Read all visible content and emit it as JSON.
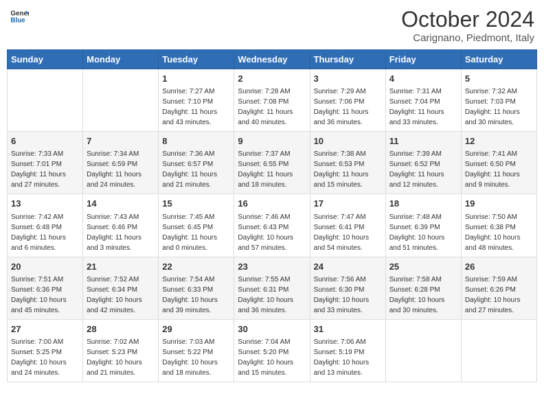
{
  "header": {
    "logo_line1": "General",
    "logo_line2": "Blue",
    "month": "October 2024",
    "location": "Carignano, Piedmont, Italy"
  },
  "days_of_week": [
    "Sunday",
    "Monday",
    "Tuesday",
    "Wednesday",
    "Thursday",
    "Friday",
    "Saturday"
  ],
  "weeks": [
    [
      {
        "day": "",
        "info": ""
      },
      {
        "day": "",
        "info": ""
      },
      {
        "day": "1",
        "info": "Sunrise: 7:27 AM\nSunset: 7:10 PM\nDaylight: 11 hours and 43 minutes."
      },
      {
        "day": "2",
        "info": "Sunrise: 7:28 AM\nSunset: 7:08 PM\nDaylight: 11 hours and 40 minutes."
      },
      {
        "day": "3",
        "info": "Sunrise: 7:29 AM\nSunset: 7:06 PM\nDaylight: 11 hours and 36 minutes."
      },
      {
        "day": "4",
        "info": "Sunrise: 7:31 AM\nSunset: 7:04 PM\nDaylight: 11 hours and 33 minutes."
      },
      {
        "day": "5",
        "info": "Sunrise: 7:32 AM\nSunset: 7:03 PM\nDaylight: 11 hours and 30 minutes."
      }
    ],
    [
      {
        "day": "6",
        "info": "Sunrise: 7:33 AM\nSunset: 7:01 PM\nDaylight: 11 hours and 27 minutes."
      },
      {
        "day": "7",
        "info": "Sunrise: 7:34 AM\nSunset: 6:59 PM\nDaylight: 11 hours and 24 minutes."
      },
      {
        "day": "8",
        "info": "Sunrise: 7:36 AM\nSunset: 6:57 PM\nDaylight: 11 hours and 21 minutes."
      },
      {
        "day": "9",
        "info": "Sunrise: 7:37 AM\nSunset: 6:55 PM\nDaylight: 11 hours and 18 minutes."
      },
      {
        "day": "10",
        "info": "Sunrise: 7:38 AM\nSunset: 6:53 PM\nDaylight: 11 hours and 15 minutes."
      },
      {
        "day": "11",
        "info": "Sunrise: 7:39 AM\nSunset: 6:52 PM\nDaylight: 11 hours and 12 minutes."
      },
      {
        "day": "12",
        "info": "Sunrise: 7:41 AM\nSunset: 6:50 PM\nDaylight: 11 hours and 9 minutes."
      }
    ],
    [
      {
        "day": "13",
        "info": "Sunrise: 7:42 AM\nSunset: 6:48 PM\nDaylight: 11 hours and 6 minutes."
      },
      {
        "day": "14",
        "info": "Sunrise: 7:43 AM\nSunset: 6:46 PM\nDaylight: 11 hours and 3 minutes."
      },
      {
        "day": "15",
        "info": "Sunrise: 7:45 AM\nSunset: 6:45 PM\nDaylight: 11 hours and 0 minutes."
      },
      {
        "day": "16",
        "info": "Sunrise: 7:46 AM\nSunset: 6:43 PM\nDaylight: 10 hours and 57 minutes."
      },
      {
        "day": "17",
        "info": "Sunrise: 7:47 AM\nSunset: 6:41 PM\nDaylight: 10 hours and 54 minutes."
      },
      {
        "day": "18",
        "info": "Sunrise: 7:48 AM\nSunset: 6:39 PM\nDaylight: 10 hours and 51 minutes."
      },
      {
        "day": "19",
        "info": "Sunrise: 7:50 AM\nSunset: 6:38 PM\nDaylight: 10 hours and 48 minutes."
      }
    ],
    [
      {
        "day": "20",
        "info": "Sunrise: 7:51 AM\nSunset: 6:36 PM\nDaylight: 10 hours and 45 minutes."
      },
      {
        "day": "21",
        "info": "Sunrise: 7:52 AM\nSunset: 6:34 PM\nDaylight: 10 hours and 42 minutes."
      },
      {
        "day": "22",
        "info": "Sunrise: 7:54 AM\nSunset: 6:33 PM\nDaylight: 10 hours and 39 minutes."
      },
      {
        "day": "23",
        "info": "Sunrise: 7:55 AM\nSunset: 6:31 PM\nDaylight: 10 hours and 36 minutes."
      },
      {
        "day": "24",
        "info": "Sunrise: 7:56 AM\nSunset: 6:30 PM\nDaylight: 10 hours and 33 minutes."
      },
      {
        "day": "25",
        "info": "Sunrise: 7:58 AM\nSunset: 6:28 PM\nDaylight: 10 hours and 30 minutes."
      },
      {
        "day": "26",
        "info": "Sunrise: 7:59 AM\nSunset: 6:26 PM\nDaylight: 10 hours and 27 minutes."
      }
    ],
    [
      {
        "day": "27",
        "info": "Sunrise: 7:00 AM\nSunset: 5:25 PM\nDaylight: 10 hours and 24 minutes."
      },
      {
        "day": "28",
        "info": "Sunrise: 7:02 AM\nSunset: 5:23 PM\nDaylight: 10 hours and 21 minutes."
      },
      {
        "day": "29",
        "info": "Sunrise: 7:03 AM\nSunset: 5:22 PM\nDaylight: 10 hours and 18 minutes."
      },
      {
        "day": "30",
        "info": "Sunrise: 7:04 AM\nSunset: 5:20 PM\nDaylight: 10 hours and 15 minutes."
      },
      {
        "day": "31",
        "info": "Sunrise: 7:06 AM\nSunset: 5:19 PM\nDaylight: 10 hours and 13 minutes."
      },
      {
        "day": "",
        "info": ""
      },
      {
        "day": "",
        "info": ""
      }
    ]
  ]
}
